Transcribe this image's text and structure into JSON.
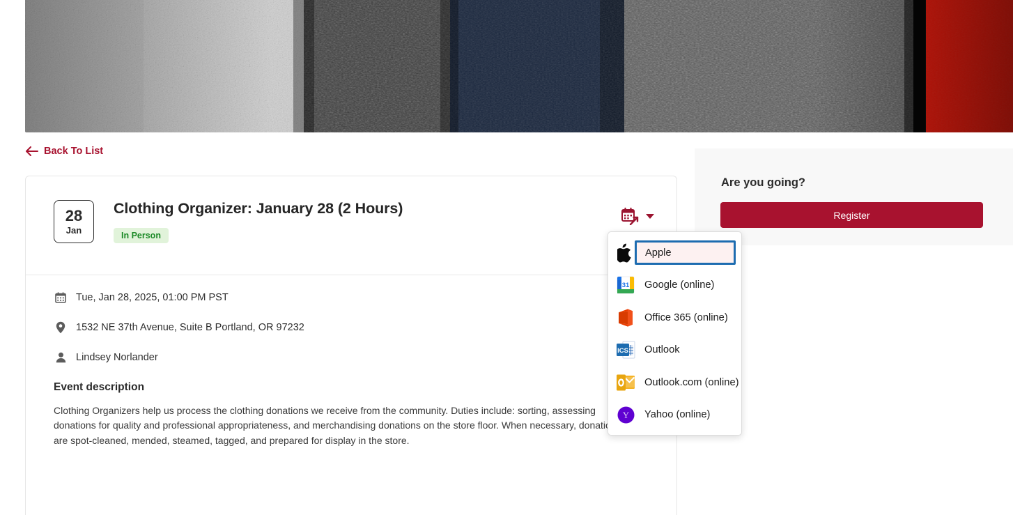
{
  "banner": {
    "name": "event-hero-image",
    "alt": "Close-up of folded knit fabrics in gray, navy and red",
    "bands": [
      {
        "color": "#c9c9c9",
        "width": 12
      },
      {
        "color": "#b8b8b8",
        "width": 16
      },
      {
        "color": "#343434",
        "width": 15
      },
      {
        "color": "#18253c",
        "width": 15
      },
      {
        "color": "#4a4a4a",
        "width": 7
      },
      {
        "color": "#5a5a5a",
        "width": 20
      },
      {
        "color": "#0e1726",
        "width": 2
      },
      {
        "color": "#e81709",
        "width": 13
      }
    ]
  },
  "back_link": {
    "label": "Back To List",
    "icon": "arrow-left-icon"
  },
  "event": {
    "date": {
      "day": "28",
      "month": "Jan"
    },
    "title": "Clothing Organizer: January 28 (2 Hours)",
    "badge": "In Person",
    "datetime": "Tue, Jan 28, 2025, 01:00 PM PST",
    "location": "1532 NE 37th Avenue, Suite B Portland, OR 97232",
    "organizer": "Lindsey Norlander",
    "description_heading": "Event description",
    "description": "Clothing Organizers help us process the clothing donations we receive from the community. Duties include: sorting, assessing donations for quality and professional appropriateness, and merchandising donations on the store floor. When necessary, donations are spot-cleaned, mended, steamed, tagged, and prepared for display in the store."
  },
  "calendar_button": {
    "icon": "add-to-calendar-icon",
    "caret": "chevron-down-icon"
  },
  "dropdown": {
    "items": [
      {
        "label": "Apple",
        "icon": "apple-icon",
        "selected": true
      },
      {
        "label": "Google (online)",
        "icon": "google-calendar-icon",
        "selected": false
      },
      {
        "label": "Office 365 (online)",
        "icon": "office-365-icon",
        "selected": false
      },
      {
        "label": "Outlook",
        "icon": "ics-file-icon",
        "selected": false
      },
      {
        "label": "Outlook.com (online)",
        "icon": "outlook-com-icon",
        "selected": false
      },
      {
        "label": "Yahoo (online)",
        "icon": "yahoo-icon",
        "selected": false
      }
    ]
  },
  "sidebar": {
    "title": "Are you going?",
    "register_label": "Register"
  },
  "colors": {
    "brand_crimson": "#A8122F",
    "badge_green_bg": "#e1f3da",
    "badge_green_text": "#1c8a27",
    "focus_blue": "#1d6cb0",
    "selected_bg": "#fdf1f1",
    "sidebar_bg": "#f8f8f8"
  }
}
